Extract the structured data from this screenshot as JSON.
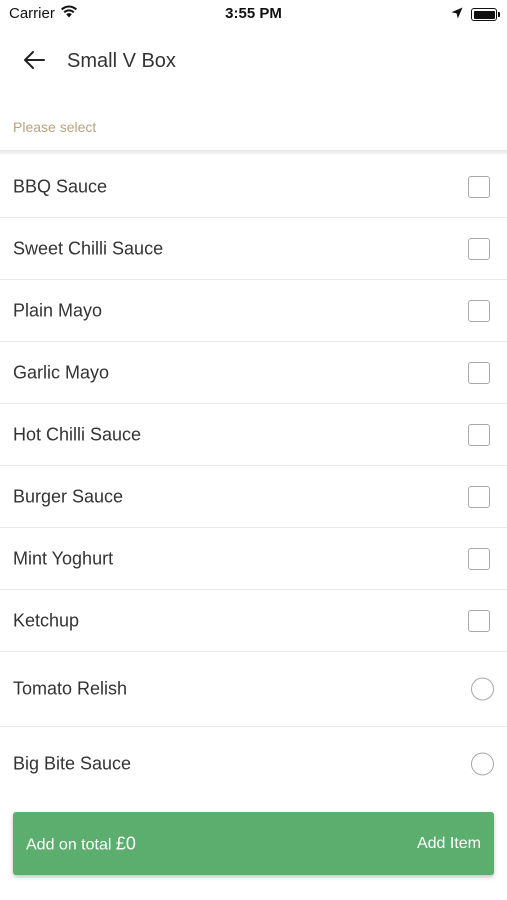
{
  "status_bar": {
    "carrier": "Carrier",
    "time": "3:55 PM",
    "icons": [
      "wifi-icon",
      "location-arrow-icon",
      "battery-icon"
    ]
  },
  "header": {
    "back_icon": "arrow-left-icon",
    "title": "Small V Box"
  },
  "prompt": "Please select",
  "options": [
    {
      "label": "BBQ Sauce",
      "control": "checkbox",
      "checked": false
    },
    {
      "label": "Sweet Chilli Sauce",
      "control": "checkbox",
      "checked": false
    },
    {
      "label": "Plain Mayo",
      "control": "checkbox",
      "checked": false
    },
    {
      "label": "Garlic Mayo",
      "control": "checkbox",
      "checked": false
    },
    {
      "label": "Hot Chilli Sauce",
      "control": "checkbox",
      "checked": false
    },
    {
      "label": "Burger Sauce",
      "control": "checkbox",
      "checked": false
    },
    {
      "label": "Mint Yoghurt",
      "control": "checkbox",
      "checked": false
    },
    {
      "label": "Ketchup",
      "control": "checkbox",
      "checked": false
    },
    {
      "label": "Tomato Relish",
      "control": "radio",
      "checked": false
    },
    {
      "label": "Big Bite Sauce",
      "control": "radio",
      "checked": false
    }
  ],
  "footer": {
    "total_label": "Add on total ",
    "total_value": "£0",
    "add_button": "Add Item"
  },
  "colors": {
    "accent": "#5bae6e",
    "prompt": "#b8a27c"
  }
}
